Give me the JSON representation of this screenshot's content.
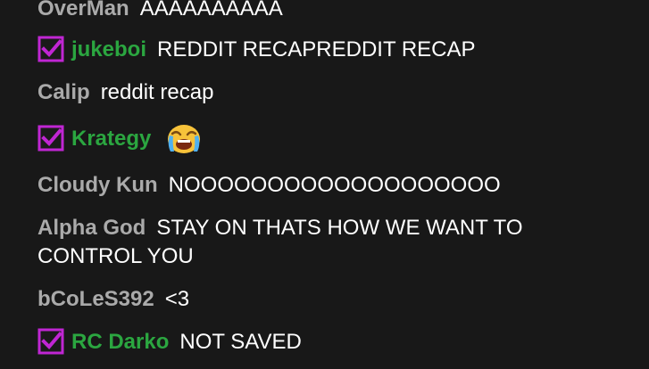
{
  "colors": {
    "background": "#181818",
    "author_default": "#aaaaaa",
    "author_member": "#2ba640",
    "message_text": "#ffffff",
    "badge": "#c026d3"
  },
  "messages": [
    {
      "author": "OverMan",
      "text": "AAAAAAAAAA",
      "member": false
    },
    {
      "author": "jukeboi",
      "text": "REDDIT RECAPREDDIT RECAP",
      "member": true,
      "badge": "checkbox-badge-icon"
    },
    {
      "author": "Calip",
      "text": "reddit recap",
      "member": false
    },
    {
      "author": "Krategy",
      "text": "",
      "member": true,
      "badge": "checkbox-badge-icon",
      "emoji": "loudly-crying-face-emoji"
    },
    {
      "author": "Cloudy Kun",
      "text": "NOOOOOOOOOOOOOOOOOOO",
      "member": false
    },
    {
      "author": "Alpha God",
      "text": "STAY ON THATS HOW WE WANT TO CONTROL YOU",
      "member": false
    },
    {
      "author": "bCoLeS392",
      "text": "<3",
      "member": false
    },
    {
      "author": "RC Darko",
      "text": "NOT SAVED",
      "member": true,
      "badge": "checkbox-badge-icon"
    }
  ]
}
